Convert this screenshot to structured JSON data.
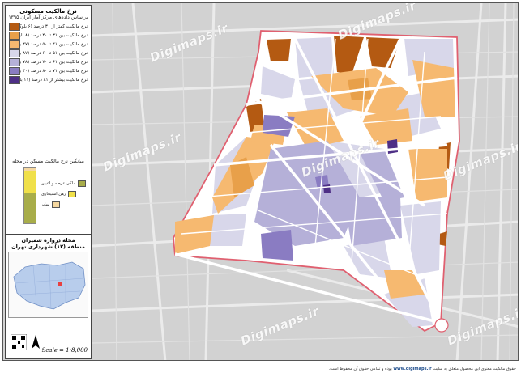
{
  "legend": {
    "title": "نرخ مالکیت مسکونی",
    "subtitle": "براساس داده‌های مرکز آمار ایران ۱۳۹۵",
    "classes": [
      {
        "label": "نرخ مالکیت کمتر از ۳۰ درصد (۶ بلوک)",
        "color": "#b45a12"
      },
      {
        "label": "نرخ مالکیت بین ۳۱ تا ۴۰ درصد (۸ بلوک)",
        "color": "#e8a04a"
      },
      {
        "label": "نرخ مالکیت بین ۴۱ تا ۵۰ درصد (۴۷ بلوک)",
        "color": "#f6b970"
      },
      {
        "label": "نرخ مالکیت بین ۵۱ تا ۶۰ درصد (۸۷ بلوک)",
        "color": "#d8d7ea"
      },
      {
        "label": "نرخ مالکیت بین ۶۱ تا ۷۰ درصد (۷۸ بلوک)",
        "color": "#b5b0d8"
      },
      {
        "label": "نرخ مالکیت بین ۷۱ تا ۸۰ درصد (۳۰ بلوک)",
        "color": "#8a7cc2"
      },
      {
        "label": "نرخ مالکیت بیشتر از ۸۱ درصد (۱۱ بلوک)",
        "color": "#4e2f86"
      }
    ]
  },
  "tenure_chart": {
    "title": "میانگین نرخ مالکیت مسکن در محله",
    "items": [
      {
        "label": "ملکی عرصه و اعیان",
        "color": "#a8ad4a",
        "value": 0.55
      },
      {
        "label": "رهن استیجاری",
        "color": "#f0e04a",
        "value": 0.4
      },
      {
        "label": "سایر",
        "color": "#f6d8a0",
        "value": 0.05
      }
    ]
  },
  "area": {
    "line1": "محله دروازه شمیران",
    "line2": "منطقه (۱۲) شهرداری تهران"
  },
  "scale_text": "Scale = 1:8,000",
  "watermark": "Digimaps.ir",
  "footer": {
    "text": "حقوق مالکیت معنوی این محصول متعلق به سایت",
    "site": "www.digimaps.ir",
    "tail": "بوده و تمامی حقوق آن محفوظ است."
  },
  "map_colors": {
    "streets": "#c9c9c9",
    "boundary": "#e06070",
    "white_roads": "#ffffff"
  }
}
